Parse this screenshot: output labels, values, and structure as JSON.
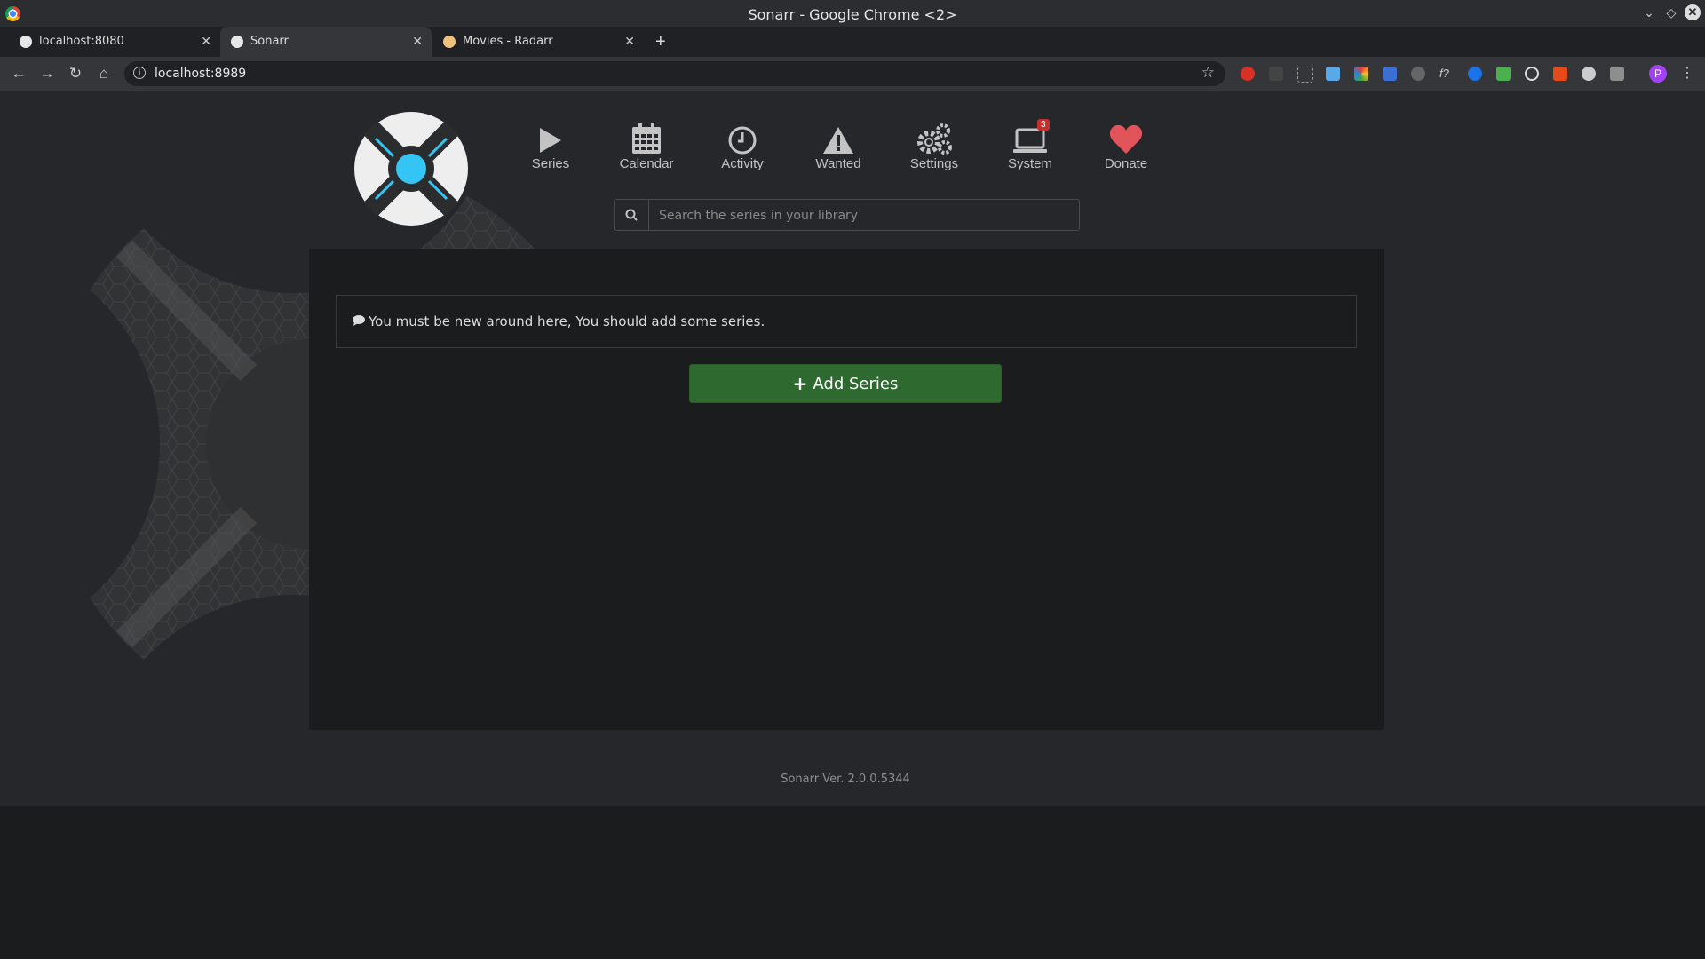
{
  "window": {
    "title": "Sonarr - Google Chrome <2>"
  },
  "tabs": [
    {
      "label": "localhost:8080",
      "active": false
    },
    {
      "label": "Sonarr",
      "active": true
    },
    {
      "label": "Movies - Radarr",
      "active": false
    }
  ],
  "address": {
    "url": "localhost:8989"
  },
  "profile": {
    "initial": "P"
  },
  "nav": {
    "items": [
      {
        "label": "Series",
        "icon": "play-icon"
      },
      {
        "label": "Calendar",
        "icon": "calendar-icon"
      },
      {
        "label": "Activity",
        "icon": "clock-icon"
      },
      {
        "label": "Wanted",
        "icon": "warning-icon"
      },
      {
        "label": "Settings",
        "icon": "gears-icon"
      },
      {
        "label": "System",
        "icon": "laptop-icon",
        "badge": "3"
      },
      {
        "label": "Donate",
        "icon": "heart-icon"
      }
    ]
  },
  "search": {
    "placeholder": "Search the series in your library"
  },
  "main": {
    "empty_message": "You must be new around here, You should add some series.",
    "add_button_label": "Add Series"
  },
  "footer": {
    "version": "Sonarr Ver. 2.0.0.5344"
  },
  "colors": {
    "accent_blue": "#35c5f4",
    "add_green": "#2e6a2f",
    "heart_red": "#e0545a",
    "badge_red": "#c4302b"
  }
}
